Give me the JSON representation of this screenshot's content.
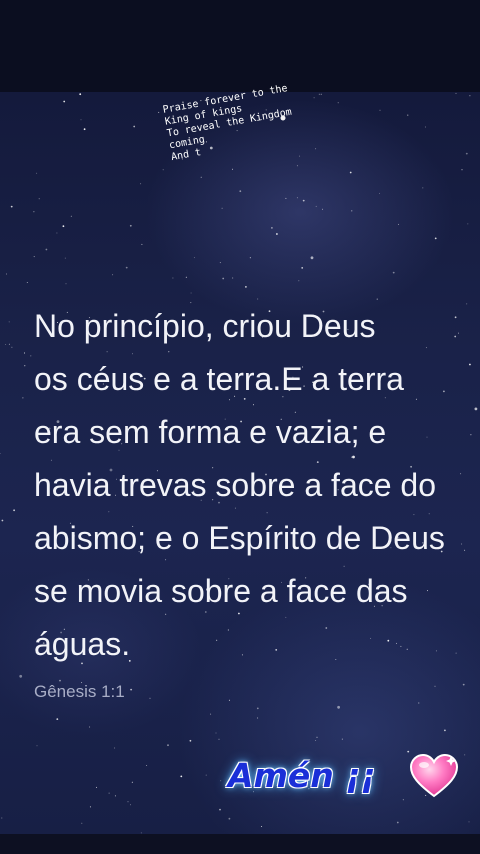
{
  "note": {
    "lines": [
      "Praise forever to the",
      "King of kings",
      "To reveal the Kingdom",
      "coming",
      "And t"
    ]
  },
  "verse": {
    "lines": [
      "No princípio, criou Deus",
      "os céus e a terra.E a terra",
      "era sem forma e vazia; e",
      "havia trevas sobre a face do",
      "abismo; e o Espírito de Deus",
      "se movia sobre a face das",
      "águas."
    ],
    "reference": "Gênesis 1:1"
  },
  "sticker": {
    "text": "Amén ¡¡",
    "icon": "sparkling-heart-icon",
    "heart_color": "#ff5fb0"
  },
  "colors": {
    "background_top": "#0b0e20",
    "sky": "#1a2249",
    "verse_text": "#f2f3f8",
    "reference_text": "#a8adc6",
    "sticker_text": "#1a2fd8"
  }
}
